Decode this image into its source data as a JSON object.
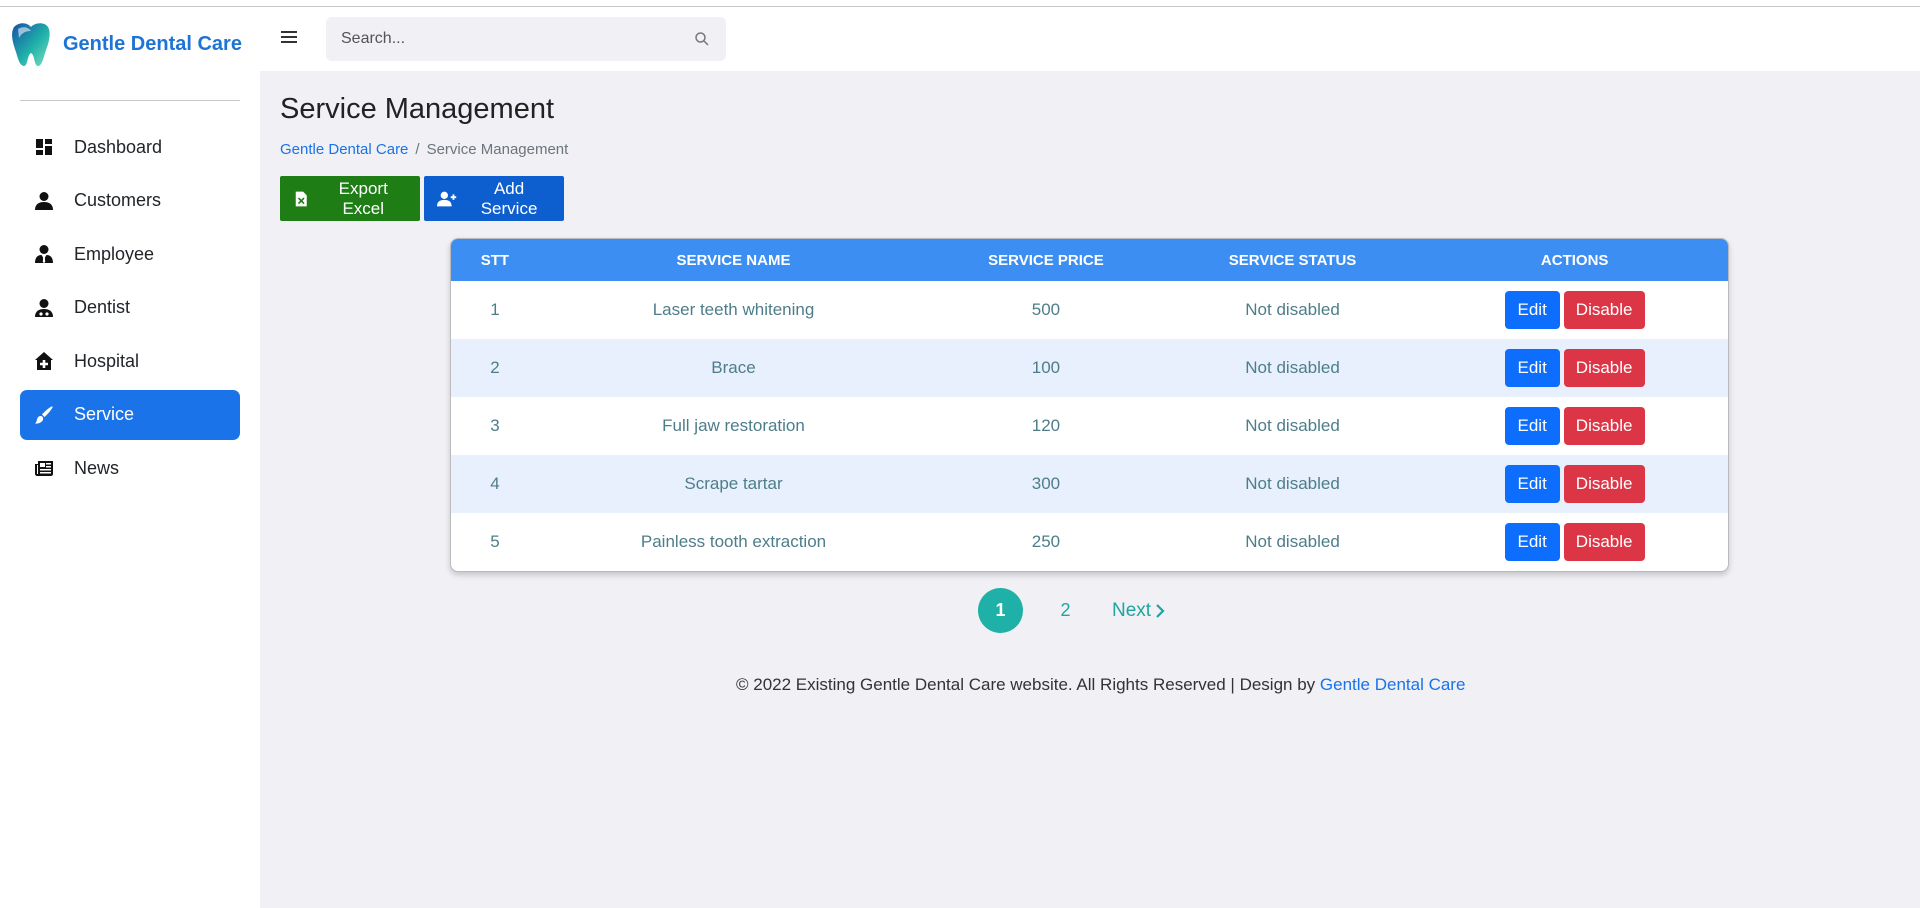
{
  "brand": {
    "name": "Gentle Dental Care",
    "colors": {
      "primary": "#1e73d6",
      "teal": "#1fb1a8"
    }
  },
  "sidebar": {
    "items": [
      {
        "label": "Dashboard",
        "icon": "dashboard-icon",
        "active": false
      },
      {
        "label": "Customers",
        "icon": "user-icon",
        "active": false
      },
      {
        "label": "Employee",
        "icon": "user-tie-icon",
        "active": false
      },
      {
        "label": "Dentist",
        "icon": "user-doctor-icon",
        "active": false
      },
      {
        "label": "Hospital",
        "icon": "hospital-icon",
        "active": false
      },
      {
        "label": "Service",
        "icon": "brush-icon",
        "active": true
      },
      {
        "label": "News",
        "icon": "newspaper-icon",
        "active": false
      }
    ]
  },
  "header": {
    "search_placeholder": "Search..."
  },
  "page": {
    "title": "Service Management",
    "breadcrumb": {
      "home": "Gentle Dental Care",
      "separator": "/",
      "current": "Service Management"
    }
  },
  "toolbar": {
    "export_label": "Export Excel",
    "add_label": "Add Service"
  },
  "table": {
    "columns": [
      "STT",
      "SERVICE NAME",
      "SERVICE PRICE",
      "SERVICE STATUS",
      "ACTIONS"
    ],
    "rows": [
      {
        "stt": "1",
        "name": "Laser teeth whitening",
        "price": "500",
        "status": "Not disabled"
      },
      {
        "stt": "2",
        "name": "Brace",
        "price": "100",
        "status": "Not disabled"
      },
      {
        "stt": "3",
        "name": "Full jaw restoration",
        "price": "120",
        "status": "Not disabled"
      },
      {
        "stt": "4",
        "name": "Scrape tartar",
        "price": "300",
        "status": "Not disabled"
      },
      {
        "stt": "5",
        "name": "Painless tooth extraction",
        "price": "250",
        "status": "Not disabled"
      }
    ],
    "edit_label": "Edit",
    "disable_label": "Disable"
  },
  "pagination": {
    "pages": [
      "1",
      "2"
    ],
    "current": "1",
    "next_label": "Next"
  },
  "footer": {
    "text": "© 2022 Existing Gentle Dental Care website. All Rights Reserved | Design by ",
    "link": "Gentle Dental Care"
  }
}
